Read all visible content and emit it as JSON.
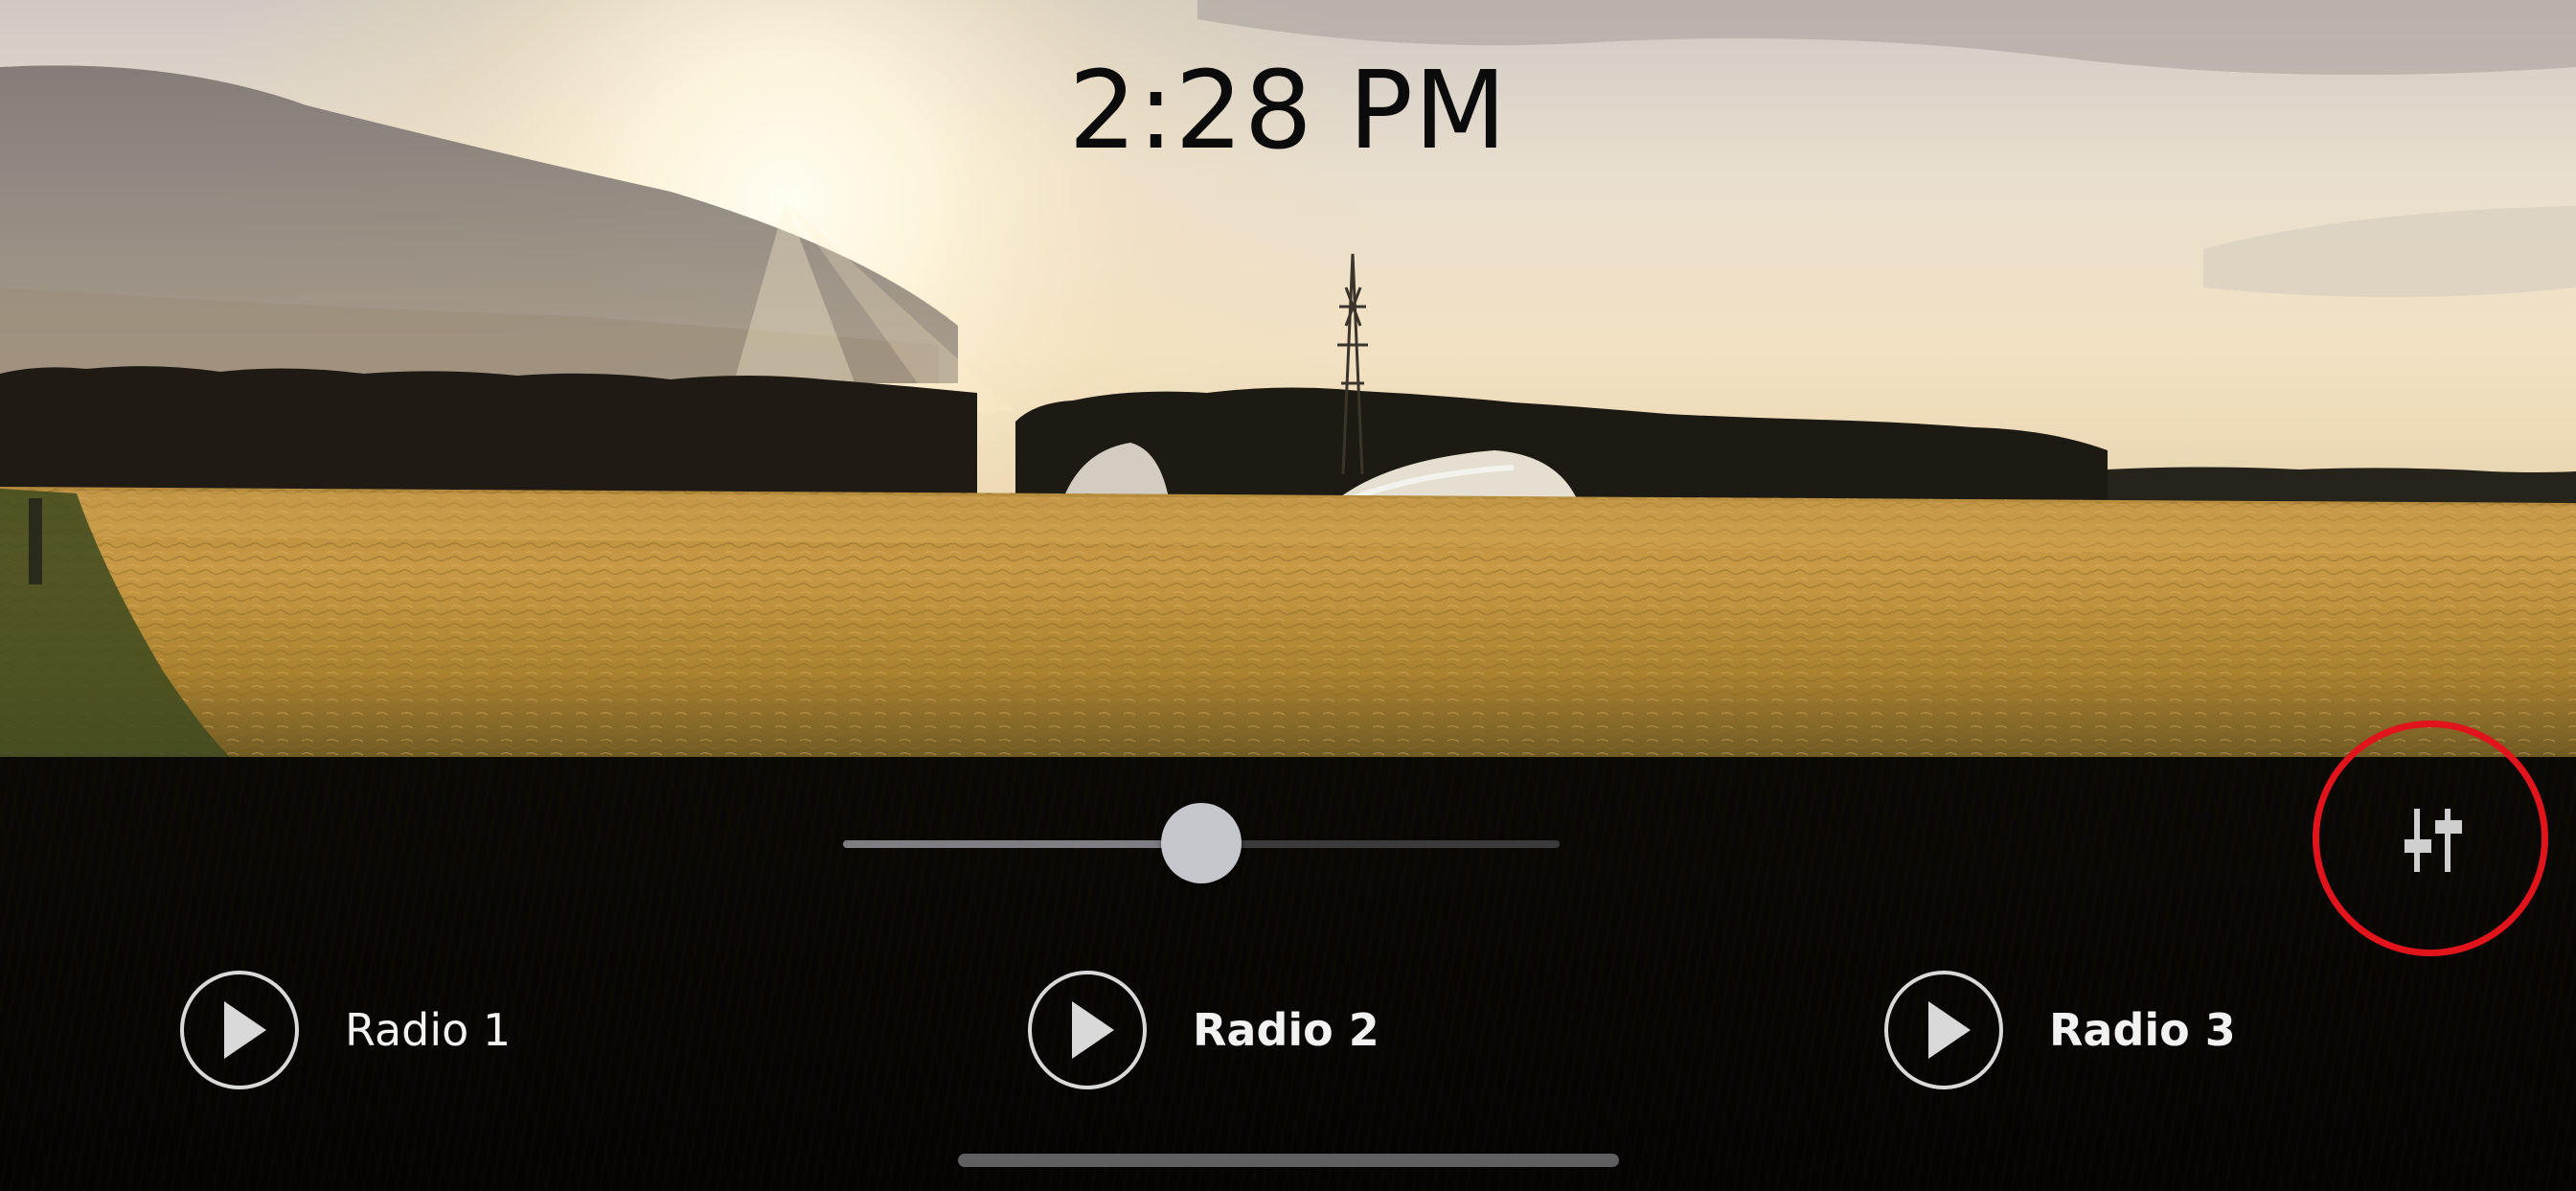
{
  "clock": {
    "time": "2:28 PM"
  },
  "background": {
    "description_icon": "landscape-photo"
  },
  "volume": {
    "level": 0.5
  },
  "toolbar": {
    "equalizer_icon": "sliders-icon",
    "highlight_color": "#e2141b"
  },
  "stations": [
    {
      "label": "Radio 1",
      "icon": "play-icon",
      "selected": false
    },
    {
      "label": "Radio 2",
      "icon": "play-icon",
      "selected": true
    },
    {
      "label": "Radio 3",
      "icon": "play-icon",
      "selected": true
    }
  ],
  "colors": {
    "panel": "#080604",
    "slider_track": "#3a3a3c",
    "slider_fill": "#7d7d82",
    "slider_thumb": "#c6c7cc",
    "text": "#f2f2f2"
  }
}
